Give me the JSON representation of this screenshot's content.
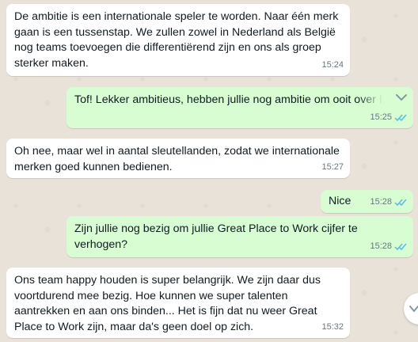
{
  "messages": [
    {
      "dir": "incoming",
      "text": "De ambitie is een internationale speler te worden. Naar één merk gaan is een tussenstap. We zullen zowel in Nederland als België nog teams toevoegen die differentiërend zijn en ons als groep sterker maken.",
      "time": "15:24"
    },
    {
      "dir": "outgoing",
      "text": "Tof! Lekker ambitieus, hebben jullie nog ambitie om ooit over Europa vestigingen te hebben?",
      "time": "15:25",
      "status": "read"
    },
    {
      "dir": "incoming",
      "text": "Oh nee, maar wel in aantal sleutellanden, zodat we internationale merken goed kunnen bedienen.",
      "time": "15:27"
    },
    {
      "dir": "outgoing",
      "text": "Nice",
      "time": "15:28",
      "status": "read"
    },
    {
      "dir": "outgoing",
      "text": "Zijn jullie nog bezig om jullie Great Place to Work cijfer te verhogen?",
      "time": "15:28",
      "status": "read"
    },
    {
      "dir": "incoming",
      "text": "Ons team happy houden is super belangrijk. We zijn daar dus voortdurend mee bezig. Hoe kunnen we super talenten aantrekken en aan ons binden... Het is fijn dat nu weer Great Place to Work zijn, maar da's geen doel op zich.",
      "time": "15:32"
    }
  ],
  "icons": {
    "read_ticks": "double-check-icon",
    "menu": "chevron-down-icon",
    "scroll": "scroll-down-icon"
  },
  "colors": {
    "incoming_bubble": "#ffffff",
    "outgoing_bubble": "#d9fdd3",
    "read_tick": "#53bdeb",
    "background": "#e9e2d8"
  }
}
